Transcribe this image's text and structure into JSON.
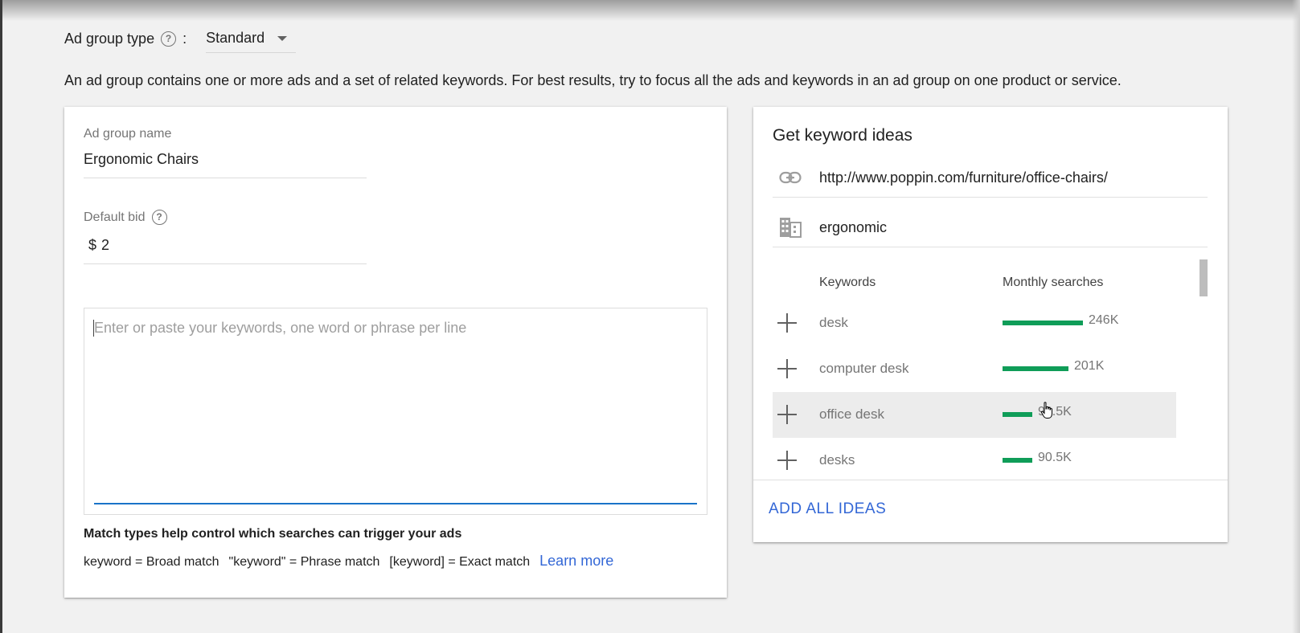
{
  "ad_group_type": {
    "label": "Ad group type",
    "colon": ":",
    "value": "Standard"
  },
  "intro_text": "An ad group contains one or more ads and a set of related keywords. For best results, try to focus all the ads and keywords in an ad group on one product or service.",
  "form": {
    "name_label": "Ad group name",
    "name_value": "Ergonomic Chairs",
    "bid_label": "Default bid",
    "bid_currency": "$",
    "bid_value": "2",
    "keywords_placeholder": "Enter or paste your keywords, one word or phrase per line",
    "match_title": "Match types help control which searches can trigger your ads",
    "match_broad": "keyword = Broad match",
    "match_phrase": "\"keyword\" = Phrase match",
    "match_exact": "[keyword] = Exact match",
    "learn_more": "Learn more"
  },
  "keyword_ideas": {
    "title": "Get keyword ideas",
    "url": "http://www.poppin.com/furniture/office-chairs/",
    "product_term": "ergonomic",
    "col_keywords": "Keywords",
    "col_searches": "Monthly searches",
    "ideas": [
      {
        "keyword": "desk",
        "searches": "246K",
        "fill": 1.0
      },
      {
        "keyword": "computer desk",
        "searches": "201K",
        "fill": 0.82
      },
      {
        "keyword": "office desk",
        "searches": "90.5K",
        "fill": 0.37
      },
      {
        "keyword": "desks",
        "searches": "90.5K",
        "fill": 0.37
      }
    ],
    "add_all": "ADD ALL IDEAS"
  },
  "colors": {
    "accent": "#3367d6",
    "bar": "#0f9d58",
    "input_underline": "#1a73c8"
  }
}
